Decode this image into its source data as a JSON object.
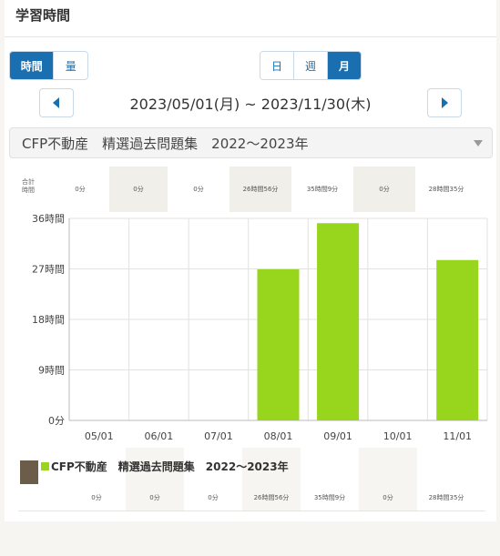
{
  "header": {
    "title": "学習時間"
  },
  "toggle_mode": {
    "time": "時間",
    "amount": "量"
  },
  "toggle_period": {
    "day": "日",
    "week": "週",
    "month": "月"
  },
  "date_range": "2023/05/01(月) ~ 2023/11/30(木)",
  "material": "CFP不動産　精選過去問題集　2022〜2023年",
  "totals_label": "合計\n時間",
  "colors": {
    "accent": "#1a6fb0",
    "bar": "#97d61d"
  },
  "chart_data": {
    "type": "bar",
    "categories": [
      "05/01",
      "06/01",
      "07/01",
      "08/01",
      "09/01",
      "10/01",
      "11/01"
    ],
    "series": [
      {
        "name": "CFP不動産　精選過去問題集　2022〜2023年",
        "values": [
          0,
          0,
          0,
          26.93,
          35.15,
          0,
          28.58
        ]
      }
    ],
    "totals": [
      "0分",
      "0分",
      "0分",
      "26時間56分",
      "35時間9分",
      "0分",
      "28時間35分"
    ],
    "yticks": [
      "36時間",
      "27時間",
      "18時間",
      "9時間",
      "0分"
    ],
    "ylim": [
      0,
      36
    ],
    "grid": true
  },
  "legend": {
    "name": "CFP不動産　精選過去問題集　2022〜2023年",
    "icon": "book-cover-icon"
  }
}
